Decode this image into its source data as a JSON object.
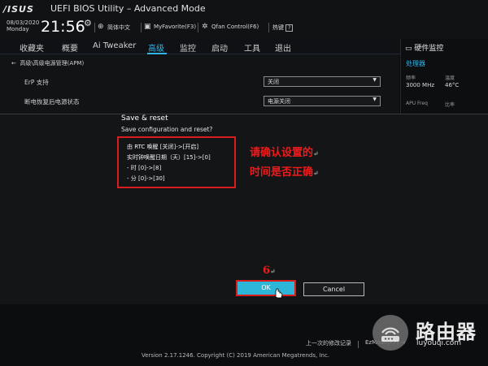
{
  "header": {
    "logo": "/ISUS",
    "title": "UEFI BIOS Utility – Advanced Mode",
    "date": "08/03/2020",
    "day": "Monday",
    "time": "21:56",
    "language": "简体中文",
    "myfavorite": "MyFavorite(F3)",
    "qfan": "Qfan Control(F6)",
    "hotkeys": "热键",
    "hotkeys_box": "?"
  },
  "menu": {
    "items": [
      "收藏夹",
      "概要",
      "Ai Tweaker",
      "高级",
      "监控",
      "启动",
      "工具",
      "退出"
    ],
    "active": "高级"
  },
  "content": {
    "breadcrumb": "高级\\高级电源管理(APM)",
    "rows": [
      {
        "label": "ErP 支持",
        "value": "关闭"
      },
      {
        "label": "断电恢复后电源状态",
        "value": "电源关闭"
      }
    ]
  },
  "monitor": {
    "title": "硬件监控",
    "section": "处理器",
    "freq_label": "频率",
    "temp_label": "温度",
    "freq_value": "3000 MHz",
    "temp_value": "46°C",
    "apu_label": "APU Freq",
    "ratio_label": "比率"
  },
  "dialog": {
    "title": "Save & reset",
    "subtitle": "Save configuration and reset?",
    "changes": [
      "由 RTC 唤醒 [关闭]->[开启]",
      "实时钟唤醒日期（天）[15]->[0]",
      "- 时 [0]->[8]",
      "- 分 [0]->[30]"
    ],
    "note_line1": "请确认设置的",
    "note_line2": "时间是否正确",
    "step_number": "6",
    "ok_label": "OK",
    "cancel_label": "Cancel"
  },
  "footer": {
    "last_modified": "上一次的修改记录",
    "ezmode": "EzMode(F7)",
    "version": "Version 2.17.1246. Copyright (C) 2019 American Megatrends, Inc."
  },
  "watermark": {
    "title": "路由器",
    "url": "luyouqi.com"
  },
  "colors": {
    "accent": "#32b4e8",
    "annotation_red": "#d91d1d",
    "ok_button": "#2eb6d8"
  }
}
